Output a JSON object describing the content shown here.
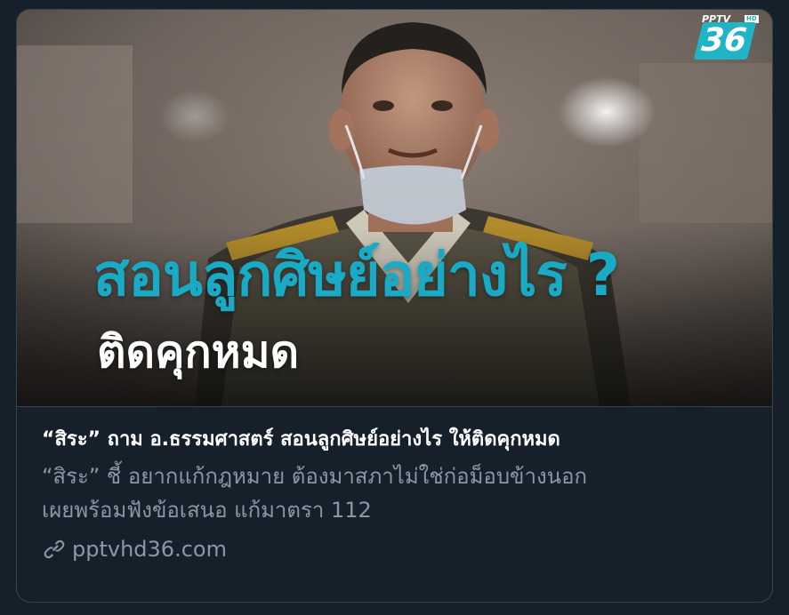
{
  "card": {
    "image": {
      "headline_main": "สอนลูกศิษย์อย่างไร ?",
      "headline_sub": "ติดคุกหมด",
      "logo_top": "PPTV",
      "logo_hd": "HD",
      "logo_number": "36"
    },
    "title": "“สิระ” ถาม อ.ธรรมศาสตร์ สอนลูกศิษย์อย่างไร ให้ติดคุกหมด",
    "description_lines": [
      "“สิระ” ชี้ อยากแก้กฎหมาย ต้องมาสภาไม่ใช่ก่อม็อบข้างนอก",
      "เผยพร้อมฟังข้อเสนอ แก้มาตรา 112"
    ],
    "domain": "pptvhd36.com",
    "domain_icon": "link-icon"
  },
  "colors": {
    "background": "#15202b",
    "border": "#38444d",
    "title": "#ffffff",
    "secondary": "#8899a6",
    "headline_accent": "#19aac6"
  }
}
